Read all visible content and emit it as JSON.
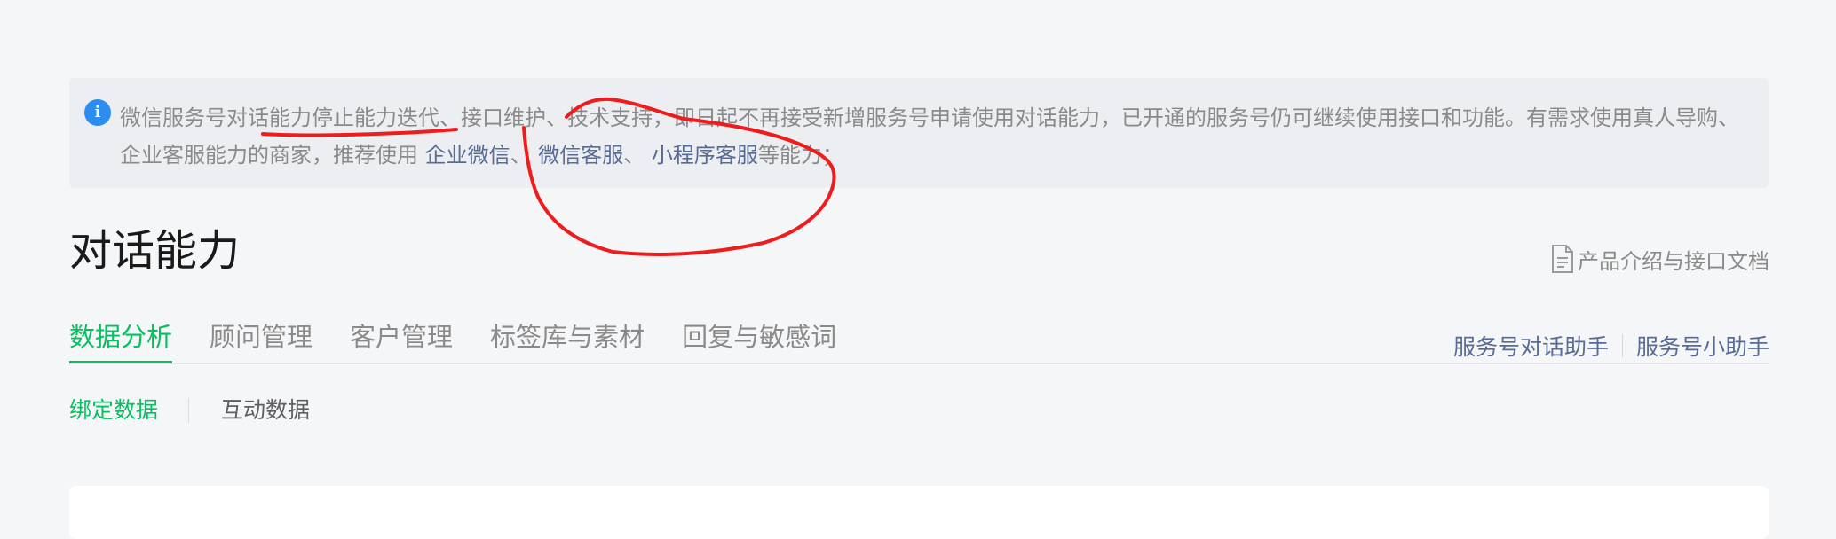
{
  "notice": {
    "icon": "info-icon",
    "text_before": "微信服务号对话能力停止能力迭代、接口维护、技术支持，即日起不再接受新增服务号申请使用对话能力，已开通的服务号仍可继续使用接口和功能。有需求使用真人导购、企业客服能力的商家，推荐使用 ",
    "link_work_wechat": "企业微信",
    "sep1": "、 ",
    "link_wechat_kf": "微信客服",
    "sep2": "、 ",
    "link_miniprogram_kf": "小程序客服",
    "text_after": "等能力；"
  },
  "page": {
    "title": "对话能力",
    "doc_link": "产品介绍与接口文档",
    "doc_icon": "document-icon"
  },
  "tabs": [
    {
      "label": "数据分析",
      "active": true
    },
    {
      "label": "顾问管理",
      "active": false
    },
    {
      "label": "客户管理",
      "active": false
    },
    {
      "label": "标签库与素材",
      "active": false
    },
    {
      "label": "回复与敏感词",
      "active": false
    }
  ],
  "assistants": {
    "dialog_helper": "服务号对话助手",
    "mini_helper": "服务号小助手"
  },
  "subtabs": [
    {
      "label": "绑定数据",
      "active": true
    },
    {
      "label": "互动数据",
      "active": false
    }
  ],
  "colors": {
    "accent_green": "#07c160",
    "link_blue": "#576b95",
    "info_blue": "#2c8df0",
    "annotation_red": "#ee1c1c"
  }
}
